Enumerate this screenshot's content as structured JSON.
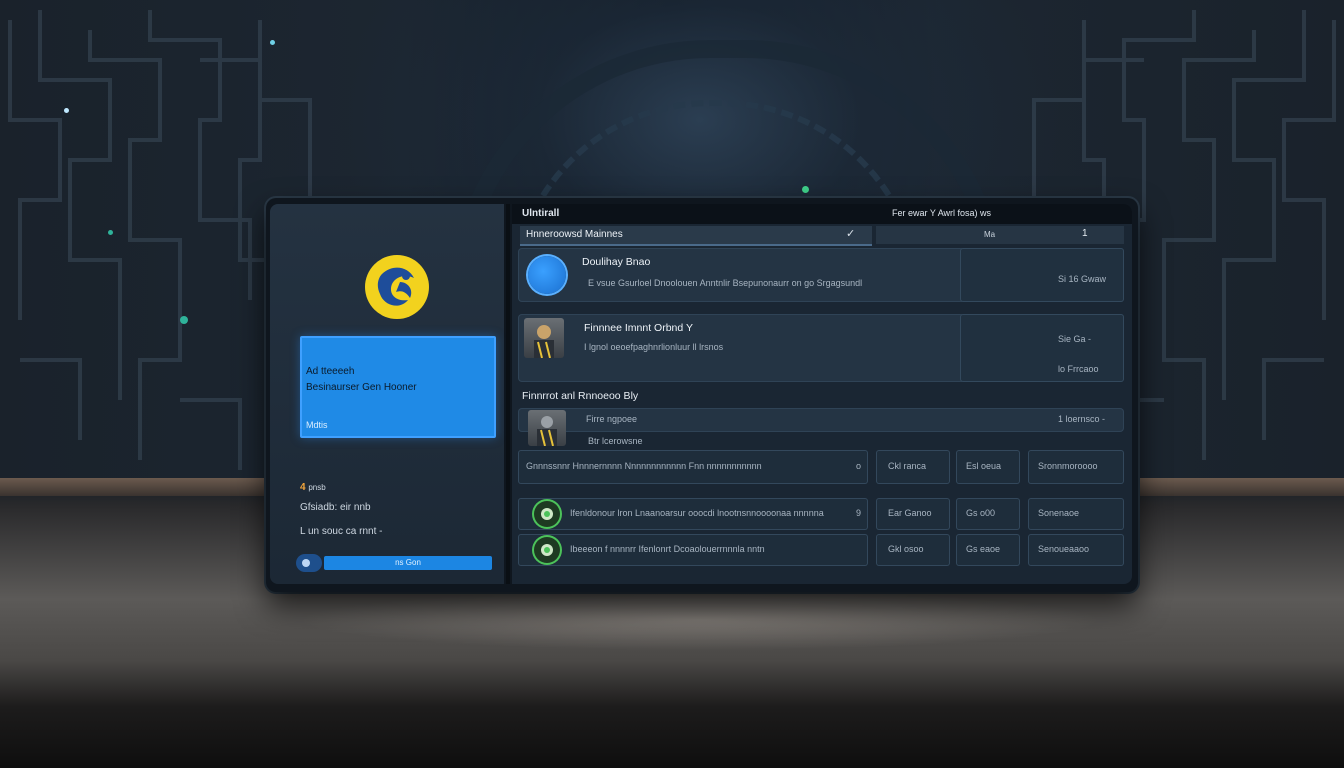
{
  "sidebar": {
    "card_title": "Ad tteeeeh",
    "card_subtitle": "Besinaurser Gen Hooner",
    "card_footer": "Mdtis",
    "meta_icon_label": "4",
    "meta_icon_suffix": "pnsb",
    "meta_line_1": "Gfsiadb: eir nnb",
    "meta_line_2": "L un souc ca rnnt -",
    "action_label": "ns Gon"
  },
  "topbar": {
    "title": "Ulntirall",
    "right_text": "Fer ewar  Y Awrl fosa) ws"
  },
  "tabs": {
    "primary_label": "Hnneroowsd  Mainnes",
    "secondary_value": "Ma",
    "secondary_count": "1"
  },
  "items": [
    {
      "title": "Doulihay Bnao",
      "subtitle": "E vsue Gsurloel Dnoolouen  Anntnlir Bsepunonaurr on go Srgagsundl",
      "side_value": "Si 16 Gwaw"
    },
    {
      "title": "Finnnee Imnnt Orbnd Y",
      "subtitle": "I lgnol oeoefpaghnrlionluur ll lrsnos",
      "side_value": "Sie Ga -",
      "side_value_2": "lo Frrcaoo"
    }
  ],
  "section": {
    "title": "Finnrrot anl  Rnnoeoo Bly",
    "subtitle": "Firre ngpoee",
    "side_value": "1 loernsco -",
    "tag": "Btr lcerowsne"
  },
  "table_rows": [
    {
      "text": "Gnnnssnnr  Hnnnernnnn Nnnnnnnnnnnn Fnn nnnnnnnnnnn",
      "mark": "o",
      "c1": "Ckl  ranca",
      "c2": "Esl  oeua",
      "c3": "Sronnmoroooo"
    },
    {
      "text": "Ifenldonour  lron  Lnaanoarsur  ooocdi  lnootnsnnoooonaa nnnnna",
      "mark": "9",
      "c1": "Ear  Ganoo",
      "c2": "Gs  o00",
      "c3": "Sonenaoe"
    },
    {
      "text": "Ibeeeon  f nnnnrr  Ifenlonrt  Dcoaolouerrnnnla nntn",
      "mark": "",
      "c1": "Gkl  osoo",
      "c2": "Gs  eaoe",
      "c3": "Senoueaaoo"
    }
  ],
  "icons": {
    "logo": "brand-logo-icon",
    "check": "check-icon",
    "toggle": "toggle-icon"
  },
  "colors": {
    "accent_blue": "#1f8ae6",
    "logo_yellow": "#f2d21e",
    "status_green": "#4cc25a",
    "panel_dark": "#1a2633"
  }
}
